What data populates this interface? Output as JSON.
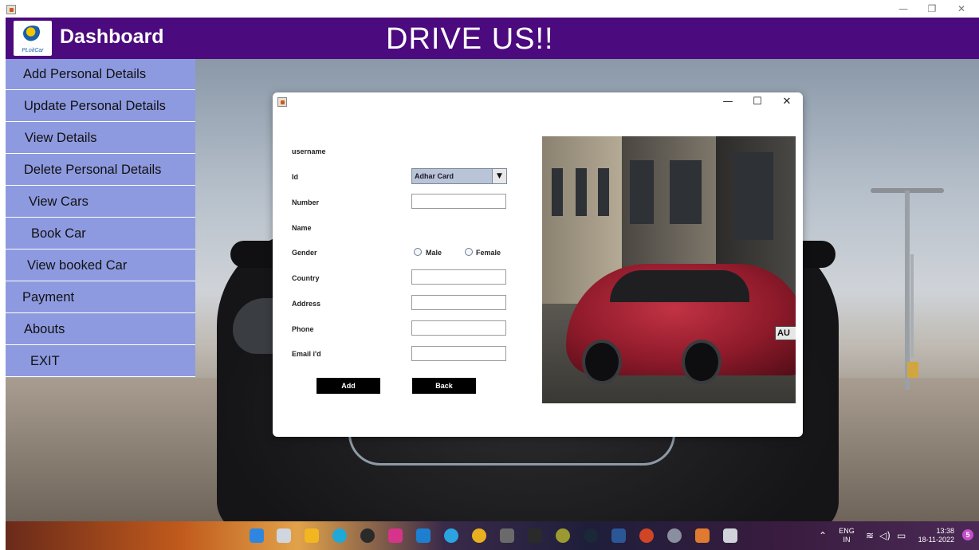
{
  "window": {
    "minimize_glyph": "—",
    "restore_glyph": "❐",
    "close_glyph": "✕"
  },
  "header": {
    "logo_text": "PLoitCar",
    "dashboard_title": "Dashboard",
    "app_title": "DRIVE US!!",
    "color": "#4b0a7d"
  },
  "sidebar": {
    "color": "#8e9ae0",
    "items": [
      {
        "label": "Add Personal Details"
      },
      {
        "label": "Update Personal Details"
      },
      {
        "label": "View Details"
      },
      {
        "label": "Delete Personal Details"
      },
      {
        "label": "View Cars"
      },
      {
        "label": "Book Car"
      },
      {
        "label": "View booked Car"
      },
      {
        "label": "Payment"
      },
      {
        "label": "Abouts"
      },
      {
        "label": "EXIT"
      }
    ]
  },
  "dialog": {
    "minimize_glyph": "—",
    "maximize_glyph": "☐",
    "close_glyph": "✕",
    "labels": {
      "username": "username",
      "id": "Id",
      "number": "Number",
      "name": "Name",
      "gender": "Gender",
      "country": "Country",
      "address": "Address",
      "phone": "Phone",
      "email": "Email i'd"
    },
    "id_select": {
      "value": "Adhar Card",
      "arrow": "▼"
    },
    "fields": {
      "number": "",
      "country": "",
      "address": "",
      "phone": "",
      "email": ""
    },
    "gender_options": {
      "male": "Male",
      "female": "Female"
    },
    "buttons": {
      "add": "Add",
      "back": "Back"
    },
    "photo_plate_text": "AU"
  },
  "taskbar": {
    "language": "ENG",
    "region": "IN",
    "time": "13:38",
    "date": "18-11-2022",
    "notification_count": "5",
    "up_glyph": "⌃",
    "wifi_glyph": "≋",
    "volume_glyph": "◁)",
    "battery_glyph": "▭",
    "apps": [
      "start-icon",
      "task-view-icon",
      "file-explorer-icon",
      "edge-icon",
      "obs-icon",
      "instagram-icon",
      "vscode-icon",
      "telegram-icon",
      "chrome-icon",
      "gta-icon",
      "epic-games-icon",
      "game-icon",
      "steam-icon",
      "word-icon",
      "powerpoint-icon",
      "settings-icon",
      "app-icon",
      "java-app-icon"
    ]
  }
}
